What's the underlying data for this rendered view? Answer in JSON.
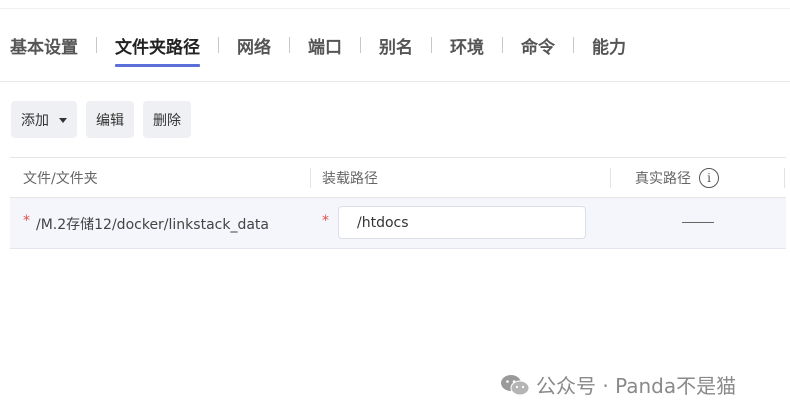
{
  "tabs": [
    {
      "label": "基本设置",
      "active": false
    },
    {
      "label": "文件夹路径",
      "active": true
    },
    {
      "label": "网络",
      "active": false
    },
    {
      "label": "端口",
      "active": false
    },
    {
      "label": "别名",
      "active": false
    },
    {
      "label": "环境",
      "active": false
    },
    {
      "label": "命令",
      "active": false
    },
    {
      "label": "能力",
      "active": false
    }
  ],
  "toolbar": {
    "add_label": "添加",
    "edit_label": "编辑",
    "delete_label": "删除"
  },
  "table": {
    "headers": {
      "file": "文件/文件夹",
      "mount": "装载路径",
      "real": "真实路径"
    },
    "rows": [
      {
        "required_mark": "*",
        "file": "/M.2存储12/docker/linkstack_data",
        "mount_required_mark": "*",
        "mount": "/htdocs",
        "real": "——"
      }
    ]
  },
  "watermark": {
    "text": "公众号 · Panda不是猫"
  },
  "icons": {
    "info": "info-icon",
    "dropdown": "caret-down-icon",
    "wechat": "wechat-icon"
  }
}
